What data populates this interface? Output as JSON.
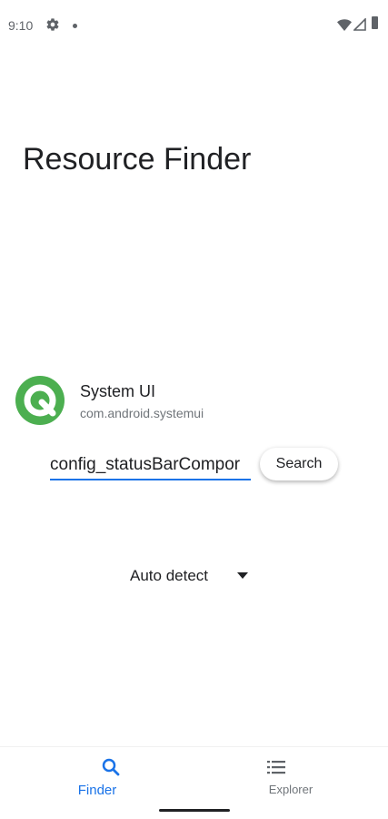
{
  "status_bar": {
    "time": "9:10"
  },
  "header": {
    "title": "Resource Finder"
  },
  "app": {
    "name": "System UI",
    "package": "com.android.systemui",
    "icon": "android-q-logo",
    "icon_color": "#4caf50"
  },
  "search": {
    "value": "config_statusBarCompor",
    "button_label": "Search",
    "accent": "#1a73e8"
  },
  "mode": {
    "selected": "Auto detect"
  },
  "bottom_nav": {
    "items": [
      {
        "label": "Finder",
        "icon": "search-icon",
        "active": true
      },
      {
        "label": "Explorer",
        "icon": "list-icon",
        "active": false
      }
    ]
  }
}
